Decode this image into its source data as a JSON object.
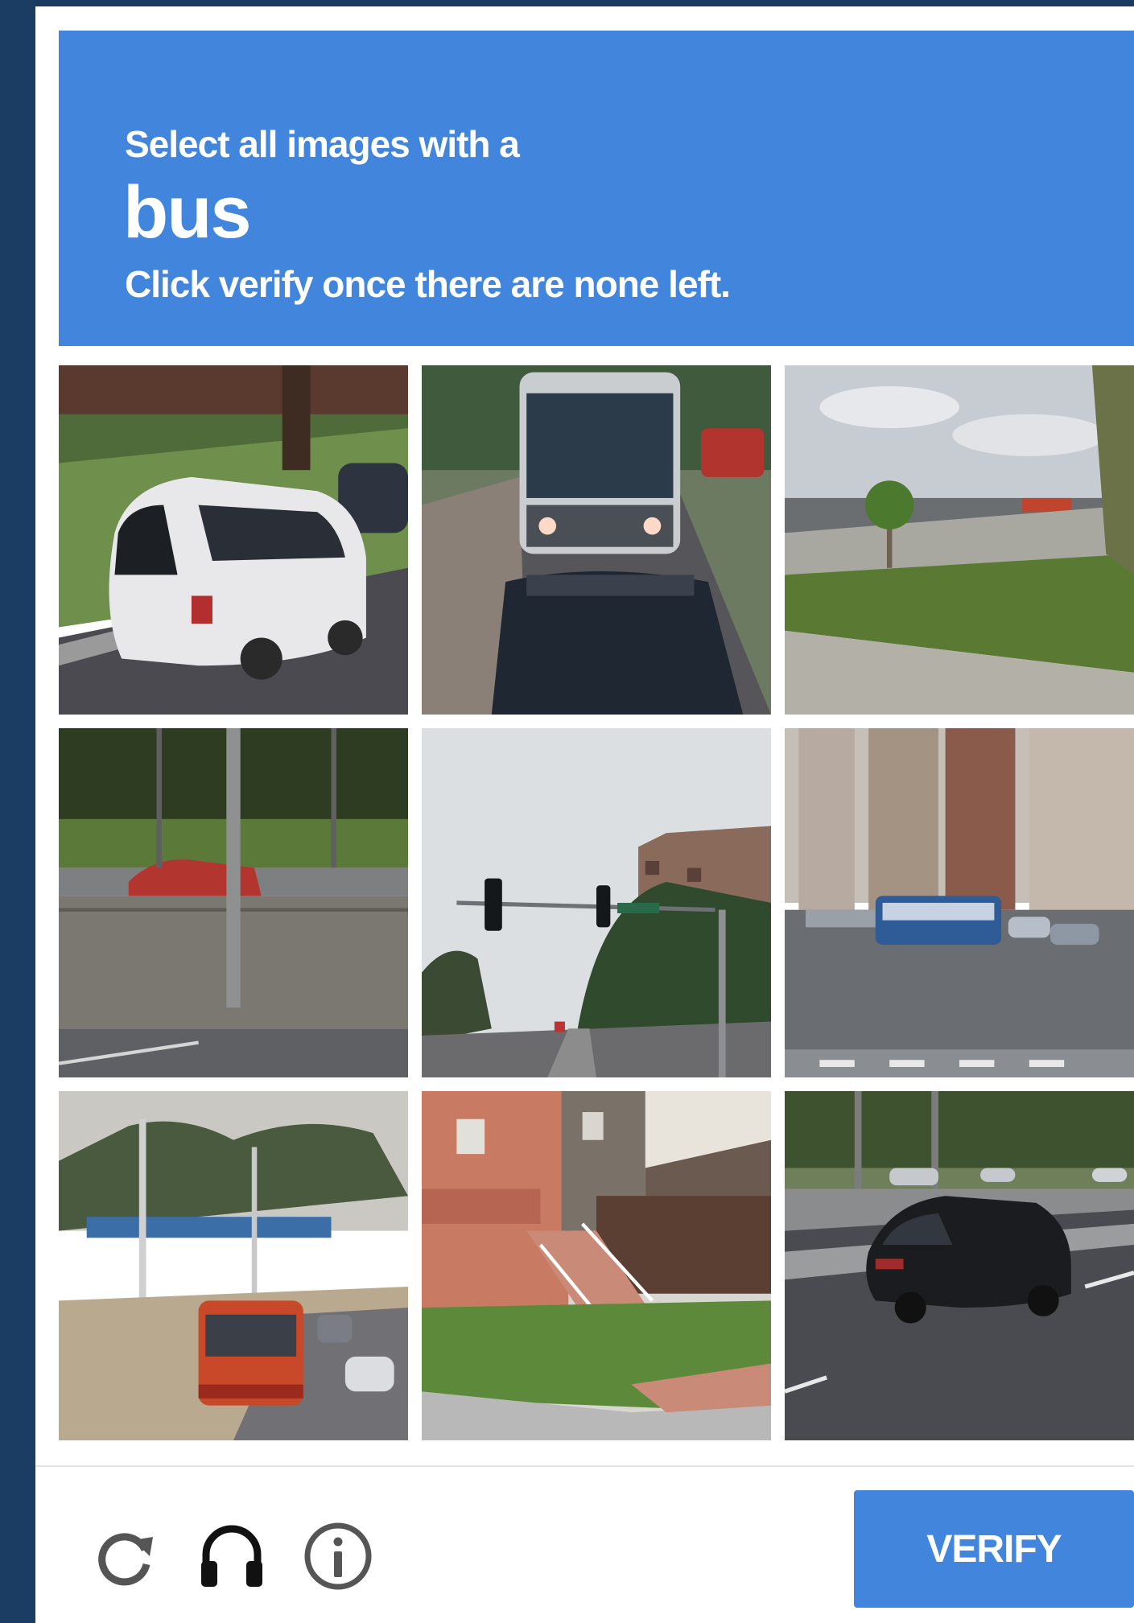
{
  "header": {
    "instruction_prefix": "Select all images with a",
    "target_object": "bus",
    "instruction_suffix": "Click verify once there are none left."
  },
  "grid": {
    "tiles": [
      {
        "content": "white-minivan-icon"
      },
      {
        "content": "bus-front-icon"
      },
      {
        "content": "road-median-icon"
      },
      {
        "content": "highway-wall-icon"
      },
      {
        "content": "traffic-light-icon"
      },
      {
        "content": "city-bus-icon"
      },
      {
        "content": "orange-bus-icon"
      },
      {
        "content": "house-stairs-icon"
      },
      {
        "content": "black-suv-icon"
      }
    ]
  },
  "footer": {
    "reload_icon": "reload-icon",
    "audio_icon": "headphones-icon",
    "info_icon": "info-icon",
    "verify_label": "VERIFY"
  },
  "colors": {
    "accent": "#4285dc",
    "header_text": "#ffffff",
    "icon_gray": "#555555"
  }
}
